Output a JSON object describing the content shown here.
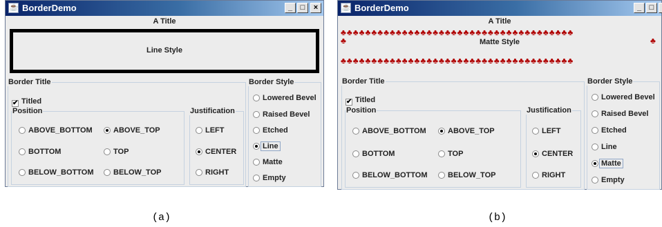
{
  "windows": [
    {
      "title": "BorderDemo",
      "controls": [
        "_",
        "□",
        "×"
      ],
      "border_title": "A Title",
      "panel_label": "Line Style",
      "border_title_group": {
        "legend": "Border Title",
        "titled_label": "Titled"
      },
      "position": {
        "legend": "Position",
        "options": [
          "ABOVE_BOTTOM",
          "ABOVE_TOP",
          "BOTTOM",
          "TOP",
          "BELOW_BOTTOM",
          "BELOW_TOP"
        ],
        "selected": "ABOVE_TOP"
      },
      "justification": {
        "legend": "Justification",
        "options": [
          "LEFT",
          "CENTER",
          "RIGHT"
        ],
        "selected": "CENTER"
      },
      "border_style": {
        "legend": "Border Style",
        "options": [
          "Lowered Bevel",
          "Raised Bevel",
          "Etched",
          "Line",
          "Matte",
          "Empty"
        ],
        "selected": "Line"
      },
      "caption": "(a)"
    },
    {
      "title": "BorderDemo",
      "controls": [
        "_",
        "□",
        "×"
      ],
      "border_title": "A Title",
      "panel_label": "Matte Style",
      "border_title_group": {
        "legend": "Border Title",
        "titled_label": "Titled"
      },
      "position": {
        "legend": "Position",
        "options": [
          "ABOVE_BOTTOM",
          "ABOVE_TOP",
          "BOTTOM",
          "TOP",
          "BELOW_BOTTOM",
          "BELOW_TOP"
        ],
        "selected": "ABOVE_TOP"
      },
      "justification": {
        "legend": "Justification",
        "options": [
          "LEFT",
          "CENTER",
          "RIGHT"
        ],
        "selected": "CENTER"
      },
      "border_style": {
        "legend": "Border Style",
        "options": [
          "Lowered Bevel",
          "Raised Bevel",
          "Etched",
          "Line",
          "Matte",
          "Empty"
        ],
        "selected": "Matte"
      },
      "caption": "(b)"
    }
  ],
  "colors": {
    "titlebar_start": "#0a246a",
    "titlebar_end": "#a6caf0",
    "matte_leaf": "#b00000",
    "window_bg": "#ececec"
  },
  "icons": {
    "app_icon": "java-cup-icon",
    "matte_tile": "maple-leaf-icon"
  }
}
